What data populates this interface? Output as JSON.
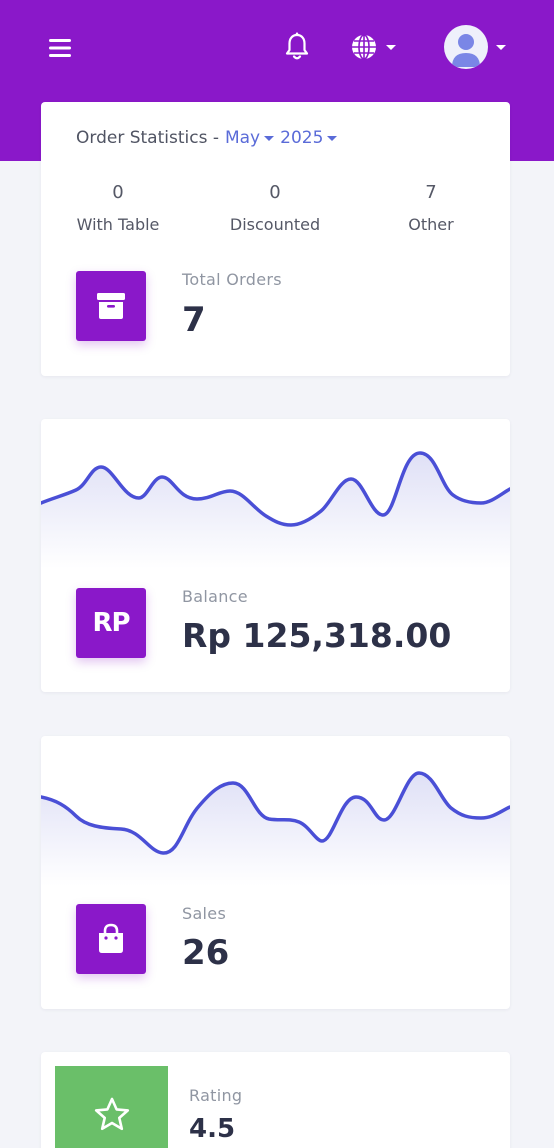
{
  "header": {
    "icons": [
      "hamburger-menu-icon",
      "bell-icon",
      "globe-icon",
      "user-avatar-icon"
    ]
  },
  "order_stats": {
    "title": "Order Statistics -",
    "month": "May",
    "year": "2025",
    "columns": [
      {
        "value": "0",
        "label": "With Table"
      },
      {
        "value": "0",
        "label": "Discounted"
      },
      {
        "value": "7",
        "label": "Other"
      }
    ],
    "total_label": "Total Orders",
    "total_value": "7"
  },
  "balance": {
    "label": "Balance",
    "value": "Rp 125,318.00",
    "icon_text": "RP"
  },
  "sales": {
    "label": "Sales",
    "value": "26"
  },
  "rating": {
    "label": "Rating",
    "value": "4.5"
  },
  "colors": {
    "primary": "#8a18c9",
    "accent": "#5a6bd8",
    "rating_green": "#6abf69",
    "line": "#4a4fd6"
  }
}
